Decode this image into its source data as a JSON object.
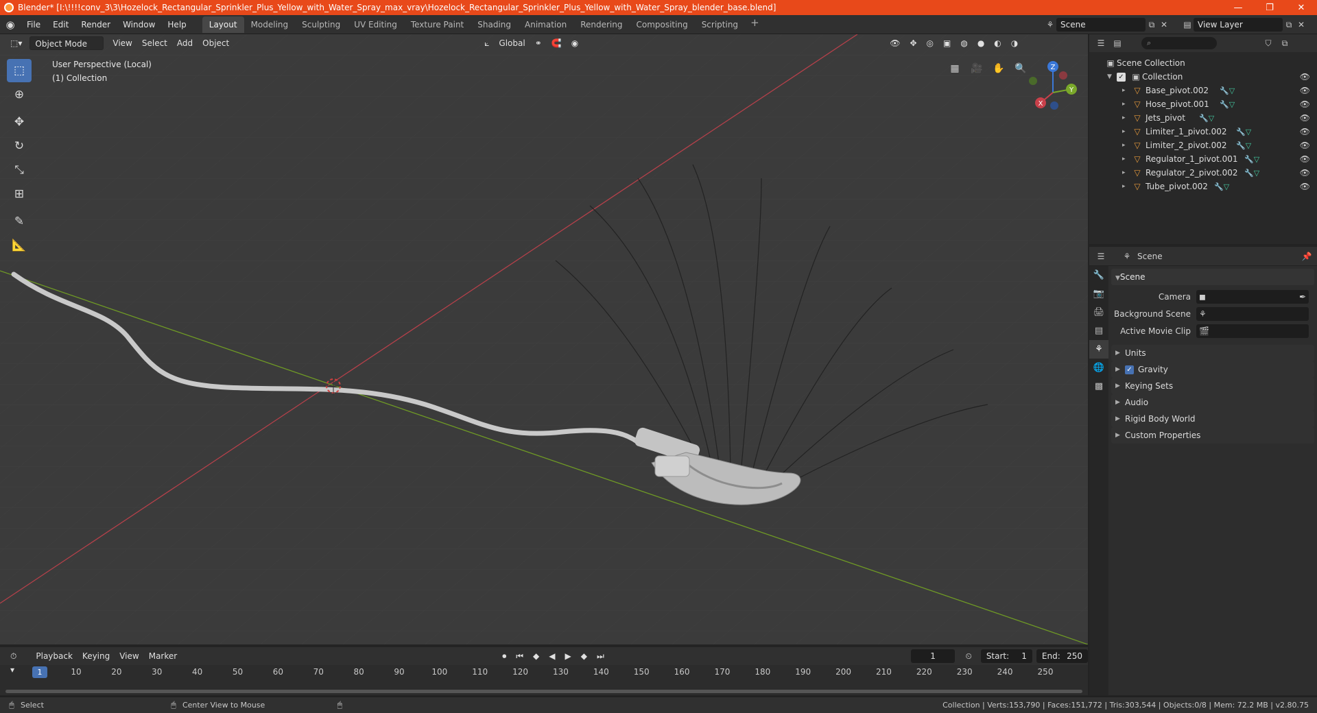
{
  "window": {
    "title": "Blender* [I:\\!!!!conv_3\\3\\Hozelock_Rectangular_Sprinkler_Plus_Yellow_with_Water_Spray_max_vray\\Hozelock_Rectangular_Sprinkler_Plus_Yellow_with_Water_Spray_blender_base.blend]",
    "minimize": "—",
    "maximize": "❐",
    "close": "✕"
  },
  "menu": [
    "File",
    "Edit",
    "Render",
    "Window",
    "Help"
  ],
  "workspaces": [
    "Layout",
    "Modeling",
    "Sculpting",
    "UV Editing",
    "Texture Paint",
    "Shading",
    "Animation",
    "Rendering",
    "Compositing",
    "Scripting"
  ],
  "workspace_add": "+",
  "scene_name": "Scene",
  "view_layer": "View Layer",
  "viewport": {
    "mode": "Object Mode",
    "menus": [
      "View",
      "Select",
      "Add",
      "Object"
    ],
    "orientation": "Global",
    "perspective": "User Perspective (Local)",
    "collection": "(1) Collection",
    "gizmo": {
      "x": "X",
      "y": "Y",
      "z": "Z"
    }
  },
  "outliner": {
    "root": "Scene Collection",
    "collection": "Collection",
    "objects": [
      "Base_pivot.002",
      "Hose_pivot.001",
      "Jets_pivot",
      "Limiter_1_pivot.002",
      "Limiter_2_pivot.002",
      "Regulator_1_pivot.001",
      "Regulator_2_pivot.002",
      "Tube_pivot.002"
    ]
  },
  "properties": {
    "context": "Scene",
    "panel": "Scene",
    "rows": [
      {
        "label": "Camera",
        "value": ""
      },
      {
        "label": "Background Scene",
        "value": ""
      },
      {
        "label": "Active Movie Clip",
        "value": ""
      }
    ],
    "subpanels": [
      "Units",
      "Gravity",
      "Keying Sets",
      "Audio",
      "Rigid Body World",
      "Custom Properties"
    ]
  },
  "timeline": {
    "menus": [
      "Playback",
      "Keying",
      "View",
      "Marker"
    ],
    "current_frame": "1",
    "start_label": "Start:",
    "start": "1",
    "end_label": "End:",
    "end": "250",
    "ticks": [
      "1",
      "10",
      "20",
      "30",
      "40",
      "50",
      "60",
      "70",
      "80",
      "90",
      "100",
      "110",
      "120",
      "130",
      "140",
      "150",
      "160",
      "170",
      "180",
      "190",
      "200",
      "210",
      "220",
      "230",
      "240",
      "250"
    ]
  },
  "status": {
    "select": "Select",
    "center_view": "Center View to Mouse",
    "info": "Collection | Verts:153,790 | Faces:151,772 | Tris:303,544 | Objects:0/8 | Mem: 72.2 MB | v2.80.75"
  },
  "colors": {
    "titlebar": "#e8491a",
    "accent": "#4772b3",
    "x_axis": "#c8404a",
    "y_axis": "#7aa82a",
    "object_icon": "#e69a3c"
  }
}
